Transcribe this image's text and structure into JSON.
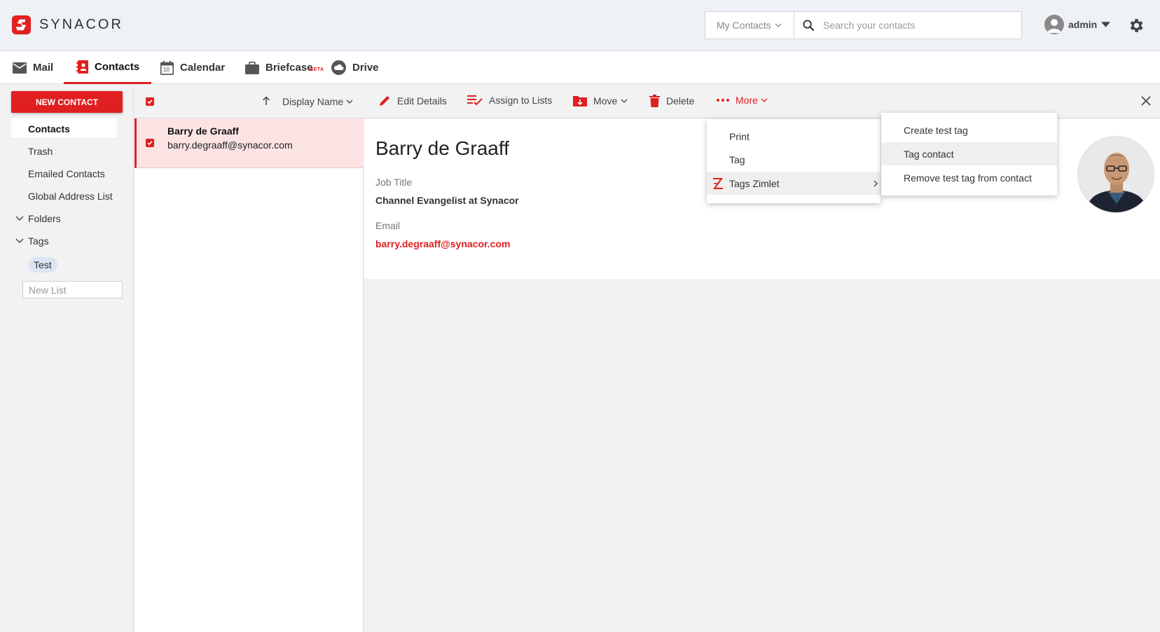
{
  "brand": {
    "name": "SYNACOR",
    "color": "#e02020"
  },
  "search": {
    "scope": "My Contacts",
    "placeholder": "Search your contacts"
  },
  "user": {
    "name": "admin"
  },
  "nav": {
    "mail": "Mail",
    "contacts": "Contacts",
    "calendar": "Calendar",
    "calendar_day": "10",
    "briefcase": "Briefcase",
    "briefcase_badge": "BETA",
    "drive": "Drive"
  },
  "sidebar": {
    "new_contact": "NEW CONTACT",
    "items": [
      "Contacts",
      "Trash",
      "Emailed Contacts",
      "Global Address List"
    ],
    "folders": "Folders",
    "tags": "Tags",
    "tag_items": [
      "Test"
    ],
    "new_list_placeholder": "New List"
  },
  "list": {
    "sort_label": "Display Name",
    "contacts": [
      {
        "name": "Barry de Graaff",
        "email": "barry.degraaff@synacor.com",
        "selected": true
      }
    ]
  },
  "toolbar": {
    "edit": "Edit Details",
    "assign": "Assign to Lists",
    "move": "Move",
    "delete": "Delete",
    "more": "More"
  },
  "detail": {
    "name": "Barry de Graaff",
    "job_title_label": "Job Title",
    "job_title": "Channel Evangelist at Synacor",
    "email_label": "Email",
    "email": "barry.degraaff@synacor.com"
  },
  "more_menu": {
    "items": [
      "Print",
      "Tag",
      "Tags Zimlet"
    ]
  },
  "sub_menu": {
    "items": [
      "Create test tag",
      "Tag contact",
      "Remove test tag from contact"
    ]
  }
}
